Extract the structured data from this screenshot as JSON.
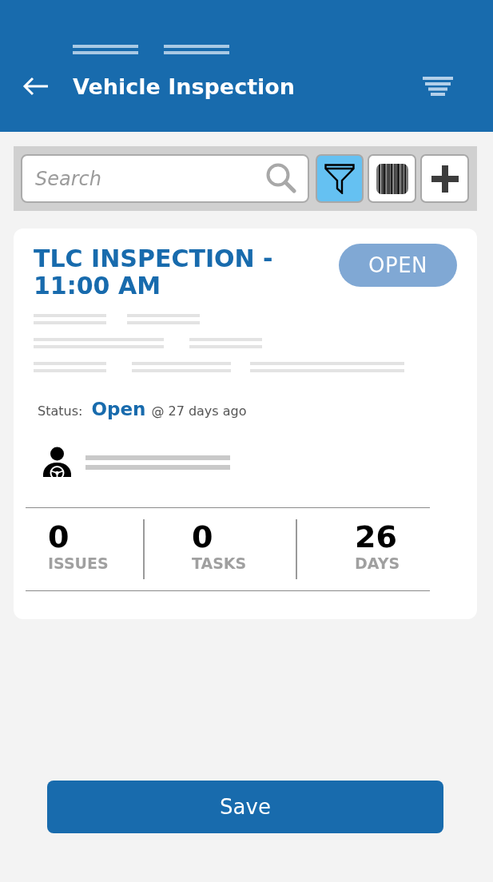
{
  "header": {
    "title": "Vehicle Inspection"
  },
  "toolbar": {
    "search": {
      "placeholder": "Search"
    },
    "buttons": [
      {
        "kind": "filter",
        "selected": true
      },
      {
        "kind": "barcode",
        "selected": false
      },
      {
        "kind": "add",
        "selected": false
      }
    ]
  },
  "card": {
    "title": "TLC INSPECTION - 11:00 AM",
    "badge": "OPEN",
    "status": {
      "label": "Status:",
      "value": "Open",
      "time": "@ 27 days ago"
    },
    "stats": [
      {
        "value": "0",
        "label": "ISSUES"
      },
      {
        "value": "0",
        "label": "TASKS"
      },
      {
        "value": "26",
        "label": "DAYS"
      }
    ]
  },
  "save_button": {
    "label": "Save"
  }
}
